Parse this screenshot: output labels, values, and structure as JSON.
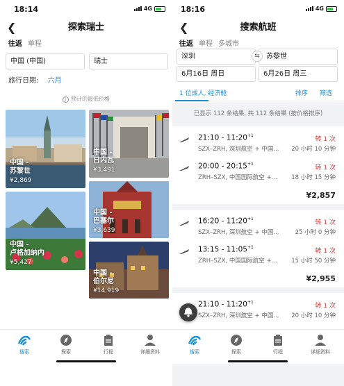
{
  "left": {
    "status": {
      "time": "18:14",
      "network": "4G"
    },
    "title": "探索瑞士",
    "tabs": [
      "往返",
      "单程"
    ],
    "origin": "中国 (中国)",
    "destination": "瑞士",
    "date_label": "旅行日期:",
    "date_value": "六月",
    "price_note": "预计的最低价格",
    "destinations": [
      {
        "name": "中国 -\n苏黎世",
        "price": "¥2,869"
      },
      {
        "name": "中国 -\n日内瓦",
        "price": "¥3,491"
      },
      {
        "name": "中国 -\n巴塞尔",
        "price": "¥3,639"
      },
      {
        "name": "中国 -\n卢格加纳内",
        "price": "¥5,427"
      },
      {
        "name": "中国 -\n伯尔尼",
        "price": "¥14,919"
      }
    ]
  },
  "right": {
    "status": {
      "time": "18:16",
      "network": "4G"
    },
    "title": "搜索航班",
    "tabs": [
      "往返",
      "单程",
      "多城市"
    ],
    "origin": "深圳",
    "destination": "苏黎世",
    "depart_date": "6月16日 周日",
    "return_date": "6月26日 周三",
    "passengers": "1 位成人, 经济舱",
    "sort_label": "排序",
    "filter_label": "筛选",
    "summary": "已显示 112 条结果, 共 112 条结果 (按价格排序)",
    "results": [
      {
        "legs": [
          {
            "time": "21:10 - 11:20",
            "plus": "+1",
            "route": "SZX–ZRH, 深圳航空 + 中国...",
            "stops": "转 1 次",
            "duration": "20 小时 10 分钟"
          },
          {
            "time": "20:00 - 20:15",
            "plus": "+1",
            "route": "ZRH–SZX, 中国国际航空 +...",
            "stops": "转 1 次",
            "duration": "18 小时 15 分钟"
          }
        ],
        "price": "¥2,857"
      },
      {
        "legs": [
          {
            "time": "16:20 - 11:20",
            "plus": "+1",
            "route": "SZX–ZRH, 深圳航空 + 中国...",
            "stops": "转 1 次",
            "duration": "25 小时 0 分钟"
          },
          {
            "time": "13:15 - 11:05",
            "plus": "+1",
            "route": "ZRH–SZX, 中国国际航空 +...",
            "stops": "转 1 次",
            "duration": "15 小时 50 分钟"
          }
        ],
        "price": "¥2,955"
      },
      {
        "legs": [
          {
            "time": "21:10 - 11:20",
            "plus": "+1",
            "route": "SZX–ZRH, 深圳航空 + 中国...",
            "stops": "转 1 次",
            "duration": "20 小时 10 分钟"
          }
        ]
      }
    ]
  },
  "tabbar": [
    "搜索",
    "探索",
    "行程",
    "详细资料"
  ],
  "colors": {
    "accent": "#1a8fd8",
    "stops": "#e23b3b"
  }
}
